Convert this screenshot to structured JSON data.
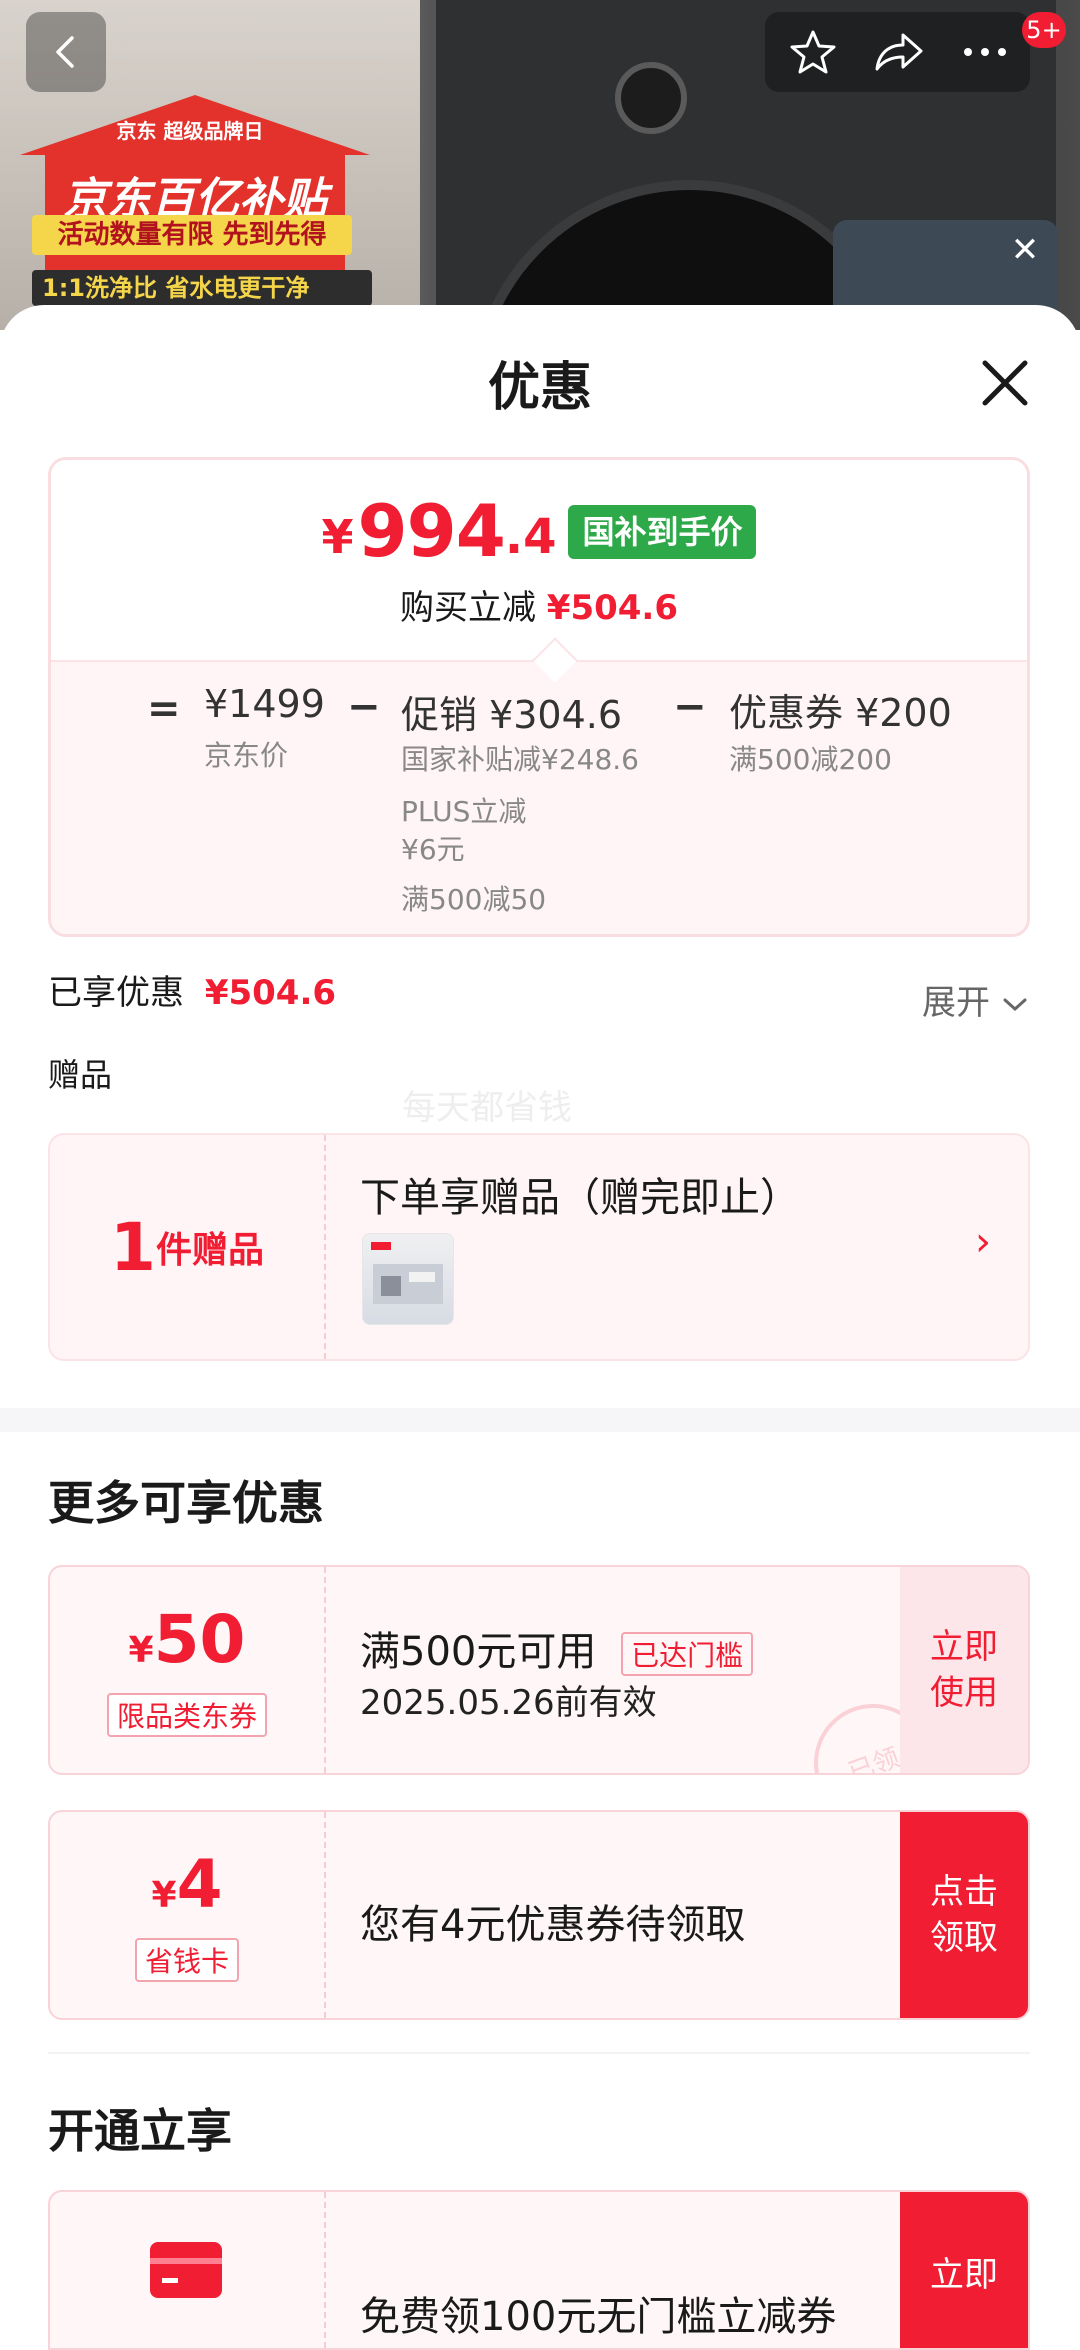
{
  "header": {
    "notification_count": "5+"
  },
  "banner": {
    "brand_small": "京东 超级品牌日",
    "brand_main": "京东百亿补贴",
    "slogan1": "活动数量有限 先到先得",
    "slogan2": "1:1洗净比 省水电更干净"
  },
  "sheet": {
    "title": "优惠"
  },
  "price_card": {
    "currency": "¥",
    "final_int": "994",
    "final_dec": ".4",
    "badge": "国补到手价",
    "save_label": "购买立减",
    "save_amount": "¥504.6",
    "eq": "=",
    "minus1": "−",
    "minus2": "−",
    "base_price": "¥1499",
    "base_label": "京东价",
    "promo_title": "促销 ¥304.6",
    "promo_item1": "国家补贴减¥248.6",
    "promo_item2a": "PLUS立减",
    "promo_item2b": "¥6元",
    "promo_item3": "满500减50",
    "coupon_title": "优惠券 ¥200",
    "coupon_item": "满500减200"
  },
  "enjoyed": {
    "label": "已享优惠",
    "amount": "¥504.6",
    "expand": "展开"
  },
  "gift": {
    "section_label": "赠品",
    "watermark": "每天都省钱",
    "count": "1",
    "unit": "件赠品",
    "title": "下单享赠品（赠完即止）"
  },
  "more": {
    "title": "更多可享优惠",
    "coupons": [
      {
        "currency": "¥",
        "amount": "50",
        "tag": "限品类东券",
        "title": "满500元可用",
        "reached": "已达门槛",
        "sub": "2025.05.26前有效",
        "button": "立即使用",
        "stamp": "已领"
      },
      {
        "currency": "¥",
        "amount": "4",
        "tag": "省钱卡",
        "title": "您有4元优惠券待领取",
        "button": "点击领取"
      }
    ]
  },
  "open": {
    "title": "开通立享",
    "item_title": "免费领100元无门槛立减券",
    "button": "立即"
  },
  "colors": {
    "accent_red": "#f01d33",
    "gov_green": "#2ea94a"
  }
}
